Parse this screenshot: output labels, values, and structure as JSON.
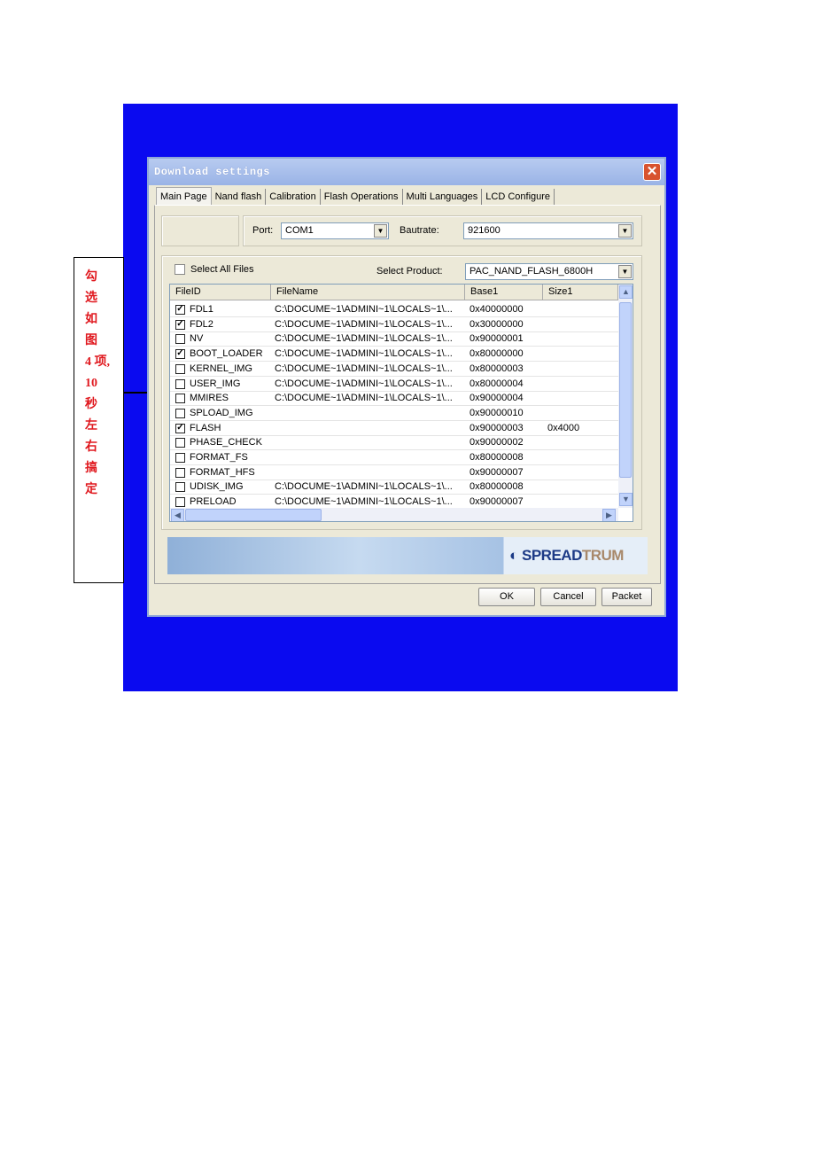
{
  "annotation": {
    "text": "勾\n选\n如\n图\n4 项,\n10\n秒\n左\n右\n搞\n定"
  },
  "dialog": {
    "title": "Download settings",
    "tabs": [
      "Main Page",
      "Nand flash",
      "Calibration",
      "Flash Operations",
      "Multi Languages",
      "LCD Configure"
    ],
    "active_tab": "Main Page",
    "port_label": "Port:",
    "port_value": "COM1",
    "baud_label": "Bautrate:",
    "baud_value": "921600",
    "select_all_label": "Select All Files",
    "select_all_checked": false,
    "product_label": "Select Product:",
    "product_value": "PAC_NAND_FLASH_6800H",
    "columns": [
      "FileID",
      "FileName",
      "Base1",
      "Size1"
    ],
    "rows": [
      {
        "checked": true,
        "id": "FDL1",
        "file": "C:\\DOCUME~1\\ADMINI~1\\LOCALS~1\\...",
        "base": "0x40000000",
        "size": ""
      },
      {
        "checked": true,
        "id": "FDL2",
        "file": "C:\\DOCUME~1\\ADMINI~1\\LOCALS~1\\...",
        "base": "0x30000000",
        "size": ""
      },
      {
        "checked": false,
        "id": "NV",
        "file": "C:\\DOCUME~1\\ADMINI~1\\LOCALS~1\\...",
        "base": "0x90000001",
        "size": ""
      },
      {
        "checked": true,
        "id": "BOOT_LOADER",
        "file": "C:\\DOCUME~1\\ADMINI~1\\LOCALS~1\\...",
        "base": "0x80000000",
        "size": ""
      },
      {
        "checked": false,
        "id": "KERNEL_IMG",
        "file": "C:\\DOCUME~1\\ADMINI~1\\LOCALS~1\\...",
        "base": "0x80000003",
        "size": ""
      },
      {
        "checked": false,
        "id": "USER_IMG",
        "file": "C:\\DOCUME~1\\ADMINI~1\\LOCALS~1\\...",
        "base": "0x80000004",
        "size": ""
      },
      {
        "checked": false,
        "id": "MMIRES",
        "file": "C:\\DOCUME~1\\ADMINI~1\\LOCALS~1\\...",
        "base": "0x90000004",
        "size": ""
      },
      {
        "checked": false,
        "id": "SPLOAD_IMG",
        "file": "",
        "base": "0x90000010",
        "size": ""
      },
      {
        "checked": true,
        "id": "FLASH",
        "file": "",
        "base": "0x90000003",
        "size": "0x4000"
      },
      {
        "checked": false,
        "id": "PHASE_CHECK",
        "file": "",
        "base": "0x90000002",
        "size": ""
      },
      {
        "checked": false,
        "id": "FORMAT_FS",
        "file": "",
        "base": "0x80000008",
        "size": ""
      },
      {
        "checked": false,
        "id": "FORMAT_HFS",
        "file": "",
        "base": "0x90000007",
        "size": ""
      },
      {
        "checked": false,
        "id": "UDISK_IMG",
        "file": "C:\\DOCUME~1\\ADMINI~1\\LOCALS~1\\...",
        "base": "0x80000008",
        "size": ""
      },
      {
        "checked": false,
        "id": "PRELOAD",
        "file": "C:\\DOCUME~1\\ADMINI~1\\LOCALS~1\\...",
        "base": "0x90000007",
        "size": ""
      }
    ],
    "logo": {
      "part1": "SPREAD",
      "part2": "TRUM"
    },
    "buttons": {
      "ok": "OK",
      "cancel": "Cancel",
      "packet": "Packet"
    }
  },
  "colors": {
    "background_panel": "#0a0af0",
    "annotation_text": "#e0181e"
  }
}
